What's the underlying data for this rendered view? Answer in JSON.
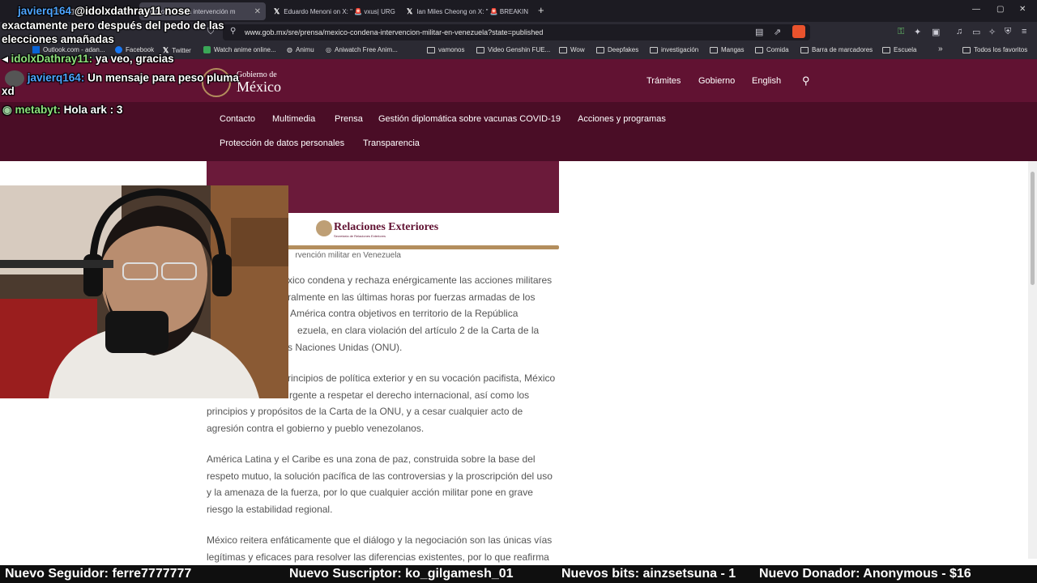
{
  "browser": {
    "tabs": [
      {
        "title": "javierq164 @idolxdathray11 nose",
        "active": false
      },
      {
        "title": "México condena intervención m",
        "active": true
      },
      {
        "title": "Eduardo Menoni on X: \" 🚨 vxus| URG",
        "active": false
      },
      {
        "title": "Ian Miles Cheong on X: \" 🚨 BREAKIN",
        "active": false
      }
    ],
    "url": "www.gob.mx/sre/prensa/mexico-condena-intervencion-militar-en-venezuela?state=published",
    "bookmarks": [
      "Outlook.com - adan...",
      "Facebook",
      "Twitter",
      "Watch anime online...",
      "Animu",
      "Aniwatch Free Anim...",
      "vamonos",
      "Video Genshin FUE...",
      "Wow",
      "Deepfakes",
      "investigación",
      "Mangas",
      "Comida",
      "Barra de marcadores",
      "Escuela"
    ],
    "bookmarks_more": "»",
    "other_bookmarks": "Todos los favoritos"
  },
  "site": {
    "logo_small": "Gobierno de",
    "logo_big": "México",
    "header_links": [
      "Trámites",
      "Gobierno",
      "English"
    ],
    "nav_row1": [
      "Contacto",
      "Multimedia",
      "Prensa",
      "Gestión diplomática sobre vacunas COVID-19",
      "Acciones y programas"
    ],
    "nav_row2": [
      "Protección de datos personales",
      "Transparencia"
    ]
  },
  "article": {
    "brand": "Relaciones Exteriores",
    "brand_sub": "Secretaría de Relaciones Exteriores",
    "caption": "rvención militar en Venezuela",
    "p1": [
      "xico condena y rechaza enérgicamente las acciones militares",
      "ralmente en las últimas horas por fuerzas armadas de los",
      "América contra objetivos en territorio de la República",
      "ezuela, en clara violación del artículo 2 de la Carta de la",
      "s Naciones Unidas (ONU)."
    ],
    "p2": [
      "rincipios de política exterior y en su vocación pacifista, México",
      "rgente a respetar el derecho internacional, así como los",
      "principios y propósitos de la Carta de la ONU, y a cesar cualquier acto de",
      "agresión contra el gobierno y pueblo venezolanos."
    ],
    "p3": [
      "América Latina y el Caribe es una zona de paz, construida sobre la base del",
      "respeto mutuo, la solución pacífica de las controversias y la proscripción del uso",
      "y la amenaza de la fuerza, por lo que cualquier acción militar pone en grave",
      "riesgo la estabilidad regional."
    ],
    "p4": [
      "México reitera enfáticamente que el diálogo y la negociación son las únicas vías",
      "legítimas y eficaces para resolver las diferencias existentes, por lo que reafirma"
    ]
  },
  "chat": [
    {
      "user": "javierq164",
      "text": "@idolxdathray11 nose"
    },
    {
      "user": "",
      "text": "exactamente pero después del pedo de las"
    },
    {
      "user": "",
      "text": "elecciones amañadas"
    },
    {
      "user": "idolxDathray11",
      "text": "ya veo, gracias"
    },
    {
      "user": "javierq164",
      "text": "Un mensaje para peso pluma"
    },
    {
      "user": "",
      "text": "xd"
    },
    {
      "user": "metabyt",
      "text": "Hola ark : 3"
    }
  ],
  "ticker": [
    "Nuevo Seguidor: ferre7777777",
    "Nuevo Suscriptor: ko_gilgamesh_01",
    "Nuevos bits: ainzsetsuna - 1",
    "Nuevo Donador: Anonymous - $16"
  ],
  "colors": {
    "header": "#611232",
    "nav": "#4a0d26",
    "gold": "#b38e5d"
  }
}
